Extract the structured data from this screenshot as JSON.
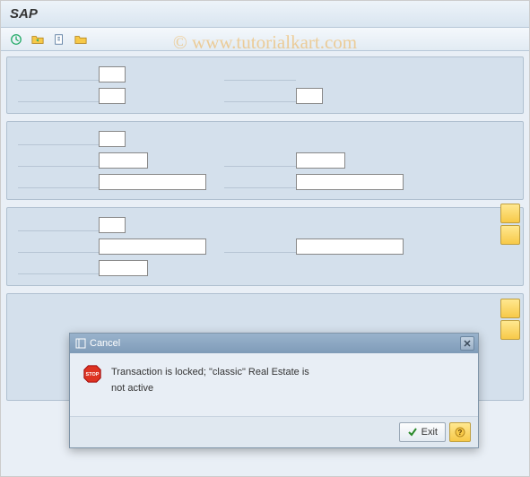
{
  "window": {
    "title": "SAP"
  },
  "watermark": "© www.tutorialkart.com",
  "toolbar": {
    "execute": "Execute",
    "get_variant": "Get Variant",
    "new": "New",
    "open": "Open"
  },
  "dialog": {
    "title": "Cancel",
    "message_line1": "Transaction is locked; \"classic\" Real Estate is",
    "message_line2": "not active",
    "exit_label": "Exit",
    "help_label": "?"
  }
}
